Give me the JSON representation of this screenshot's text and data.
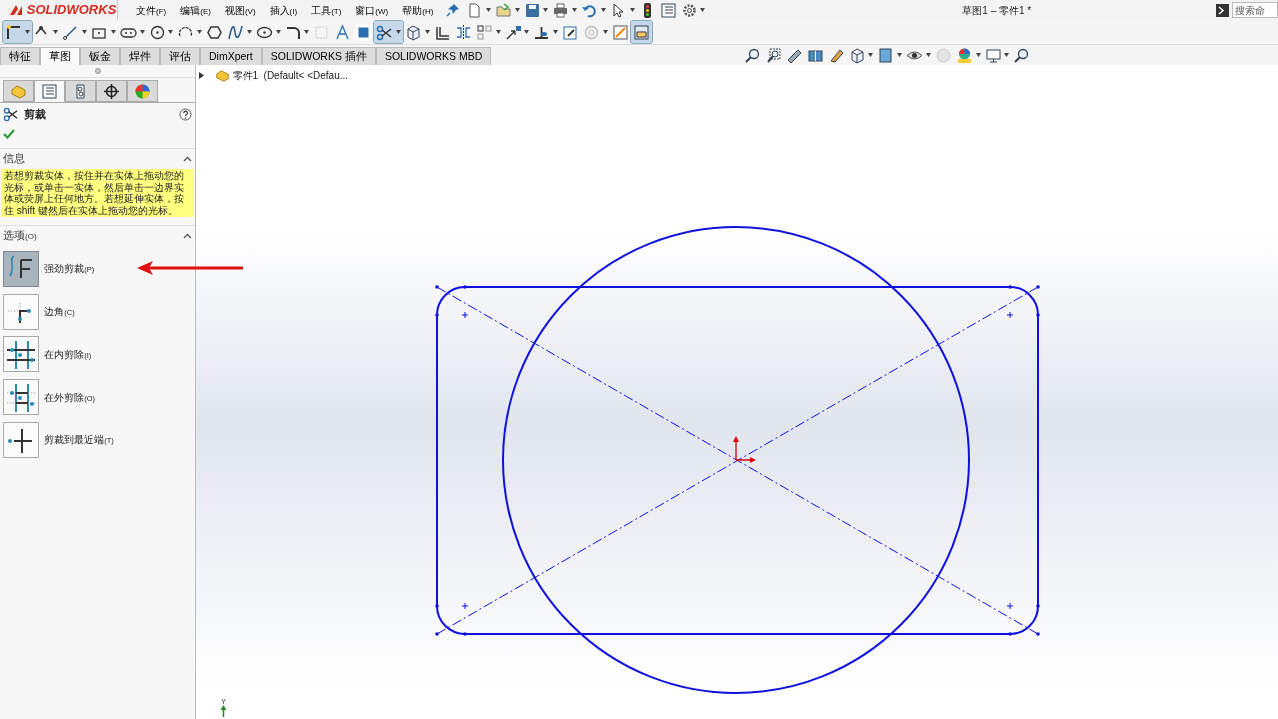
{
  "app": {
    "logo": "SOLIDWORKS",
    "title": "草图1 – 零件1 *",
    "search": {
      "placeholder": "搜索命"
    }
  },
  "menus": [
    {
      "label": "文件",
      "accel": "(F)"
    },
    {
      "label": "编辑",
      "accel": "(E)"
    },
    {
      "label": "视图",
      "accel": "(V)"
    },
    {
      "label": "插入",
      "accel": "(I)"
    },
    {
      "label": "工具",
      "accel": "(T)"
    },
    {
      "label": "窗口",
      "accel": "(W)"
    },
    {
      "label": "帮助",
      "accel": "(H)"
    }
  ],
  "quick_tools": [
    {
      "kind": "pin",
      "dropdown": false
    },
    {
      "kind": "new-document",
      "dropdown": true
    },
    {
      "kind": "open",
      "dropdown": true
    },
    {
      "kind": "save",
      "dropdown": true
    },
    {
      "kind": "print",
      "dropdown": true
    },
    {
      "kind": "undo",
      "dropdown": true
    },
    {
      "kind": "pointer",
      "dropdown": true
    },
    {
      "kind": "traffic-light",
      "dropdown": false
    },
    {
      "kind": "list",
      "dropdown": false
    },
    {
      "kind": "gear",
      "dropdown": true
    }
  ],
  "sketch_tools": [
    {
      "kind": "sketch",
      "dropdown": true,
      "active": true
    },
    {
      "kind": "dimension",
      "dropdown": true,
      "active": false
    },
    {
      "kind": "line",
      "dropdown": true,
      "active": false
    },
    {
      "kind": "rectangle",
      "dropdown": true,
      "active": false
    },
    {
      "kind": "slot",
      "dropdown": true,
      "active": false
    },
    {
      "kind": "circle",
      "dropdown": true,
      "active": false
    },
    {
      "kind": "arc",
      "dropdown": true,
      "active": false
    },
    {
      "kind": "polygon",
      "dropdown": false,
      "active": false
    },
    {
      "kind": "spline",
      "dropdown": true,
      "active": false
    },
    {
      "kind": "ellipse",
      "dropdown": true,
      "active": false
    },
    {
      "kind": "fillet",
      "dropdown": true,
      "active": false
    },
    {
      "kind": "plane",
      "dropdown": false,
      "active": false
    },
    {
      "kind": "text",
      "dropdown": false,
      "active": false
    },
    {
      "kind": "point",
      "dropdown": false,
      "active": false
    },
    {
      "kind": "trim",
      "dropdown": true,
      "active": true
    },
    {
      "kind": "cube",
      "dropdown": true,
      "active": false
    },
    {
      "kind": "offset",
      "dropdown": false,
      "active": false
    },
    {
      "kind": "mirror",
      "dropdown": false,
      "active": false
    },
    {
      "kind": "pattern",
      "dropdown": true,
      "active": false
    },
    {
      "kind": "move",
      "dropdown": true,
      "active": false
    },
    {
      "kind": "relation",
      "dropdown": true,
      "active": false
    },
    {
      "kind": "repair",
      "dropdown": false,
      "active": false
    },
    {
      "kind": "disabled-circle",
      "dropdown": true,
      "active": false
    },
    {
      "kind": "instant",
      "dropdown": false,
      "active": false
    },
    {
      "kind": "shaded",
      "dropdown": false,
      "active": true
    }
  ],
  "command_tabs": [
    {
      "label": "特征",
      "selected": false
    },
    {
      "label": "草图",
      "selected": true
    },
    {
      "label": "钣金",
      "selected": false
    },
    {
      "label": "焊件",
      "selected": false
    },
    {
      "label": "评估",
      "selected": false
    },
    {
      "label": "DimXpert",
      "selected": false
    },
    {
      "label": "SOLIDWORKS 插件",
      "selected": false
    },
    {
      "label": "SOLIDWORKS MBD",
      "selected": false
    }
  ],
  "view_tools": [
    {
      "kind": "zoom",
      "dropdown": false
    },
    {
      "kind": "zoom-area",
      "dropdown": false
    },
    {
      "kind": "previous-view",
      "dropdown": false
    },
    {
      "kind": "section",
      "dropdown": false
    },
    {
      "kind": "dynamic",
      "dropdown": false
    },
    {
      "kind": "cube",
      "dropdown": true
    },
    {
      "kind": "display",
      "dropdown": true
    },
    {
      "kind": "eye",
      "dropdown": true
    },
    {
      "kind": "sphere",
      "dropdown": false
    },
    {
      "kind": "scene",
      "dropdown": true
    },
    {
      "kind": "monitor",
      "dropdown": true
    },
    {
      "kind": "zoom",
      "dropdown": false
    }
  ],
  "panel_tabs": [
    {
      "kind": "tree",
      "selected": false
    },
    {
      "kind": "list",
      "selected": true
    },
    {
      "kind": "config",
      "selected": false
    },
    {
      "kind": "target",
      "selected": false
    },
    {
      "kind": "colors",
      "selected": false
    }
  ],
  "property_manager": {
    "title": "剪裁",
    "info": {
      "heading": "信息",
      "expanded": true,
      "message": "若想剪裁实体，按住并在实体上拖动您的光标，或单击一实体，然后单击一边界实体或荧屏上任何地方。若想延伸实体，按住 shift 键然后在实体上拖动您的光标。"
    },
    "options": {
      "heading": "选项",
      "accel": "(O)",
      "expanded": true,
      "items": [
        {
          "kind": "power",
          "label": "强劲剪裁",
          "accel": "(P)",
          "selected": true
        },
        {
          "kind": "corner",
          "label": "边角",
          "accel": "(C)",
          "selected": false
        },
        {
          "kind": "inside",
          "label": "在内剪除",
          "accel": "(I)",
          "selected": false
        },
        {
          "kind": "outside",
          "label": "在外剪除",
          "accel": "(O)",
          "selected": false
        },
        {
          "kind": "nearest",
          "label": "剪裁到最近端",
          "accel": "(T)",
          "selected": false
        }
      ]
    }
  },
  "feature_tree": {
    "expanded": false,
    "name": "零件1",
    "config": "(Default< <Defau..."
  },
  "triad": {
    "axis": "Y"
  }
}
